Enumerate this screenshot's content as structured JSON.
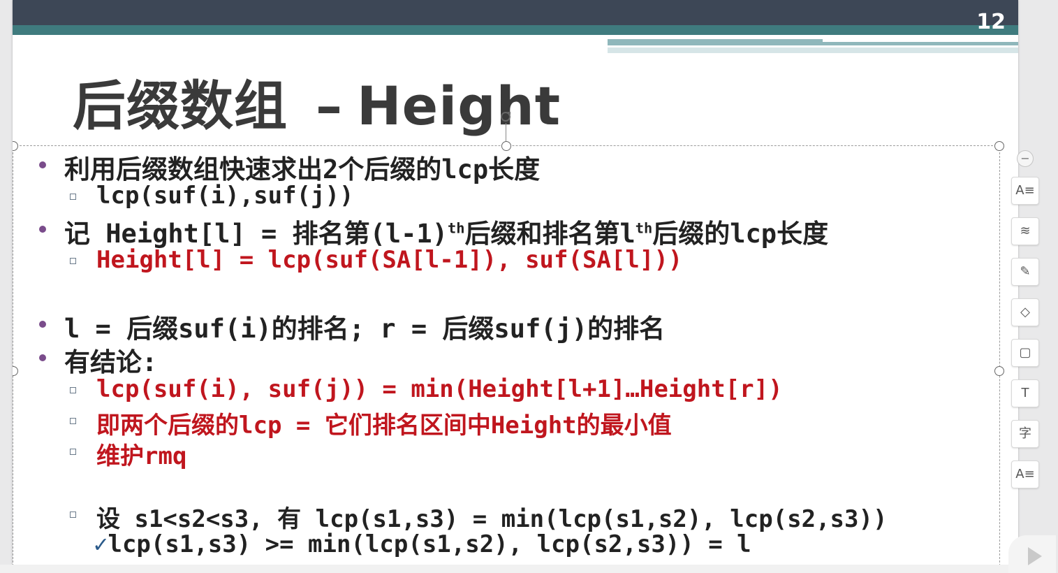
{
  "slide": {
    "number": "12",
    "title_cn": "后缀数组",
    "title_dash": "–",
    "title_en": "Height"
  },
  "content": {
    "b1": "利用后缀数组快速求出2个后缀的lcp长度",
    "b1_s1": "lcp(suf(i),suf(j))",
    "b2_pre": "记 Height[l] = 排名第(l-1)",
    "b2_sup1": "th",
    "b2_mid": "后缀和排名第l",
    "b2_sup2": "th",
    "b2_post": "后缀的lcp长度",
    "b2_s1": "Height[l] = lcp(suf(SA[l-1]), suf(SA[l]))",
    "b3": "l = 后缀suf(i)的排名; r = 后缀suf(j)的排名",
    "b4": "有结论:",
    "b4_s1": "lcp(suf(i), suf(j)) = min(Height[l+1]…Height[r])",
    "b4_s2": "即两个后缀的lcp = 它们排名区间中Height的最小值",
    "b4_s3": "维护rmq",
    "b4_s4": "设 s1<s2<s3, 有 lcp(s1,s3) = min(lcp(s1,s2), lcp(s2,s3))",
    "check_mark": "✓",
    "b4_s5": "lcp(s1,s3) >= min(lcp(s1,s2), lcp(s2,s3)) = l"
  },
  "toolbar": {
    "collapse": "−",
    "items": [
      "A≡",
      "≋",
      "✎",
      "◇",
      "▢",
      "T",
      "字",
      "A≡"
    ]
  },
  "colors": {
    "accent_red": "#c0161e",
    "bullet_purple": "#7a4c8b",
    "header_dark": "#3d4756",
    "header_teal": "#3f7b7e"
  }
}
